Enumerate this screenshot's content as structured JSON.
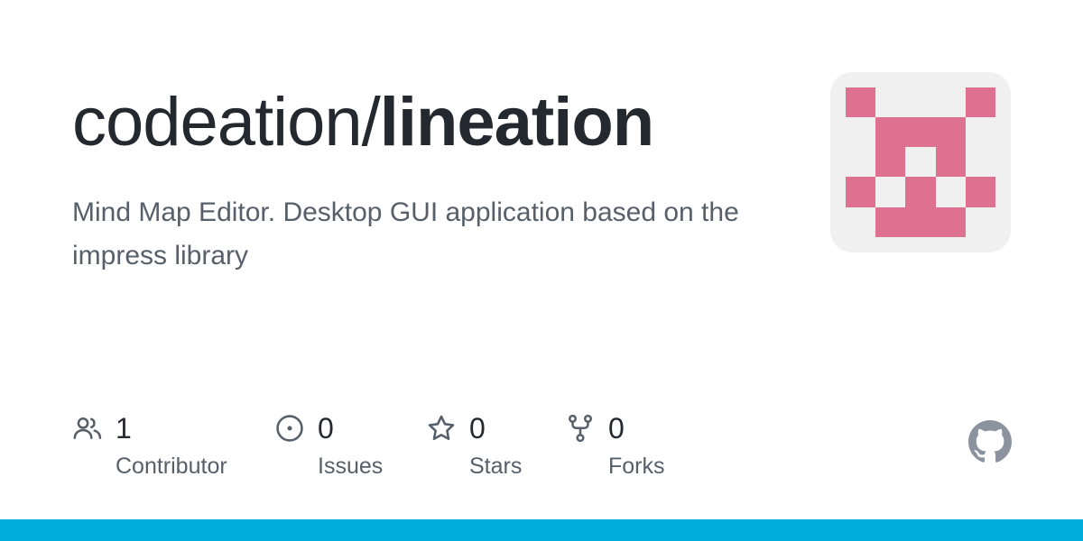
{
  "repo": {
    "owner": "codeation/",
    "name": "lineation",
    "description": "Mind Map Editor. Desktop GUI application based on the impress library"
  },
  "stats": {
    "contributors": {
      "count": "1",
      "label": "Contributor",
      "icon": "people-icon"
    },
    "issues": {
      "count": "0",
      "label": "Issues",
      "icon": "issue-opened-icon"
    },
    "stars": {
      "count": "0",
      "label": "Stars",
      "icon": "star-icon"
    },
    "forks": {
      "count": "0",
      "label": "Forks",
      "icon": "repo-forked-icon"
    }
  },
  "colors": {
    "avatar_pink": "#de718f",
    "avatar_bg": "#f0f0f0",
    "accent_bar": "#00acdb",
    "title": "#24292f",
    "muted": "#57606a",
    "icon": "#57606a",
    "github_mark": "#8b949e"
  }
}
